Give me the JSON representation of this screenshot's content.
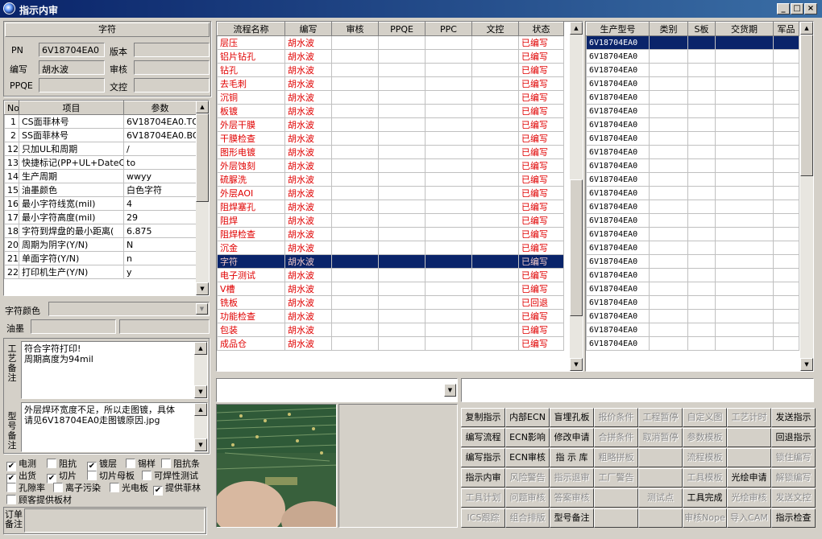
{
  "window": {
    "title": "指示内审",
    "min": "_",
    "max": "□",
    "close": "×"
  },
  "left": {
    "section_title": "字符",
    "pn_label": "PN",
    "pn_value": "6V18704EA0",
    "version_label": "版本",
    "version_value": "",
    "writer_label": "编写",
    "writer_value": "胡水波",
    "review_label": "审核",
    "review_value": "",
    "ppqe_label": "PPQE",
    "ppqe_value": "",
    "doc_label": "文控",
    "doc_value": "",
    "params": {
      "headers": [
        "No",
        "项目",
        "参数"
      ],
      "rows": [
        [
          "1",
          "CS面菲林号",
          "6V18704EA0.TO"
        ],
        [
          "2",
          "SS面菲林号",
          "6V18704EA0.BO"
        ],
        [
          "12",
          "只加UL和周期",
          "/"
        ],
        [
          "13",
          "快捷标记(PP+UL+DateCo",
          "to"
        ],
        [
          "14",
          "生产周期",
          "wwyy"
        ],
        [
          "15",
          "油墨颜色",
          "白色字符"
        ],
        [
          "16",
          "最小字符线宽(mil)",
          "4"
        ],
        [
          "17",
          "最小字符高度(mil)",
          "29"
        ],
        [
          "18",
          "字符到焊盘的最小距离(",
          "6.875"
        ],
        [
          "20",
          "周期为阴字(Y/N)",
          "N"
        ],
        [
          "21",
          "单面字符(Y/N)",
          "n"
        ],
        [
          "22",
          "打印机生产(Y/N)",
          "y"
        ]
      ]
    },
    "char_color_label": "字符颜色",
    "char_color_value": "",
    "ink_label": "油墨",
    "process_note_label": "工艺备注",
    "process_note_lines": [
      "符合字符打印!",
      "周期高度为94mil"
    ],
    "model_note_label": "型号备注",
    "model_note_lines": [
      "外层焊环宽度不足，所以走图镀，具体",
      "请见6V18704EA0走图镀原因.jpg"
    ],
    "checks": [
      {
        "label": "电测",
        "checked": true
      },
      {
        "label": "阻抗",
        "checked": false
      },
      {
        "label": "镀层",
        "checked": true
      },
      {
        "label": "锡样",
        "checked": false
      },
      {
        "label": "阻抗条",
        "checked": false
      },
      {
        "label": "出货",
        "checked": true
      },
      {
        "label": "切片",
        "checked": true
      },
      {
        "label": "切片母板",
        "checked": false
      },
      {
        "label": "可焊性测试",
        "checked": false
      },
      {
        "label": "孔隙率",
        "checked": false
      },
      {
        "label": "离子污染",
        "checked": false
      },
      {
        "label": "光电板",
        "checked": false
      },
      {
        "label": "提供菲林",
        "checked": true
      },
      {
        "label": "顾客提供板材",
        "checked": false
      }
    ],
    "order_note_label": "订单备注"
  },
  "flow": {
    "headers": [
      "流程名称",
      "编写",
      "审核",
      "PPQE",
      "PPC",
      "文控",
      "状态"
    ],
    "rows": [
      [
        "层压",
        "胡水波",
        "",
        "",
        "",
        "",
        "已编写"
      ],
      [
        "铝片钻孔",
        "胡水波",
        "",
        "",
        "",
        "",
        "已编写"
      ],
      [
        "钻孔",
        "胡水波",
        "",
        "",
        "",
        "",
        "已编写"
      ],
      [
        "去毛刺",
        "胡水波",
        "",
        "",
        "",
        "",
        "已编写"
      ],
      [
        "沉铜",
        "胡水波",
        "",
        "",
        "",
        "",
        "已编写"
      ],
      [
        "板镀",
        "胡水波",
        "",
        "",
        "",
        "",
        "已编写"
      ],
      [
        "外层干膜",
        "胡水波",
        "",
        "",
        "",
        "",
        "已编写"
      ],
      [
        "干膜检查",
        "胡水波",
        "",
        "",
        "",
        "",
        "已编写"
      ],
      [
        "图形电镀",
        "胡水波",
        "",
        "",
        "",
        "",
        "已编写"
      ],
      [
        "外层蚀刻",
        "胡水波",
        "",
        "",
        "",
        "",
        "已编写"
      ],
      [
        "硫脲洗",
        "胡水波",
        "",
        "",
        "",
        "",
        "已编写"
      ],
      [
        "外层AOI",
        "胡水波",
        "",
        "",
        "",
        "",
        "已编写"
      ],
      [
        "阻焊塞孔",
        "胡水波",
        "",
        "",
        "",
        "",
        "已编写"
      ],
      [
        "阻焊",
        "胡水波",
        "",
        "",
        "",
        "",
        "已编写"
      ],
      [
        "阻焊检查",
        "胡水波",
        "",
        "",
        "",
        "",
        "已编写"
      ],
      [
        "沉金",
        "胡水波",
        "",
        "",
        "",
        "",
        "已编写"
      ],
      [
        "字符",
        "胡水波",
        "",
        "",
        "",
        "",
        "已编写"
      ],
      [
        "电子测试",
        "胡水波",
        "",
        "",
        "",
        "",
        "已编写"
      ],
      [
        "V槽",
        "胡水波",
        "",
        "",
        "",
        "",
        "已编写"
      ],
      [
        "铣板",
        "胡水波",
        "",
        "",
        "",
        "",
        "已回退"
      ],
      [
        "功能检查",
        "胡水波",
        "",
        "",
        "",
        "",
        "已编写"
      ],
      [
        "包装",
        "胡水波",
        "",
        "",
        "",
        "",
        "已编写"
      ],
      [
        "成品仓",
        "胡水波",
        "",
        "",
        "",
        "",
        "已编写"
      ]
    ],
    "selected_index": 16
  },
  "models": {
    "headers": [
      "生产型号",
      "类别",
      "S板",
      "交货期",
      "军品"
    ],
    "rows": [
      "6V18704EA0",
      "6V18704EA0",
      "6V18704EA0",
      "6V18704EA0",
      "6V18704EA0",
      "6V18704EA0",
      "6V18704EA0",
      "6V18704EA0",
      "6V18704EA0",
      "6V18704EA0",
      "6V18704EA0",
      "6V18704EA0",
      "6V18704EA0",
      "6V18704EA0",
      "6V18704EA0",
      "6V18704EA0",
      "6V18704EA0",
      "6V18704EA0",
      "6V18704EA0",
      "6V18704EA0",
      "6V18704EA0",
      "6V18704EA0",
      "6V18704EA0"
    ],
    "selected_index": 0
  },
  "buttons": [
    [
      "复制指示",
      "内部ECN",
      "盲埋孔板",
      "报价条件",
      "工程暂停",
      "自定义图",
      "工艺计时",
      "发送指示"
    ],
    [
      "编写流程",
      "ECN影响",
      "修改申请",
      "合拼条件",
      "取消暂停",
      "参数模板",
      "",
      "回退指示"
    ],
    [
      "编写指示",
      "ECN审核",
      "指 示 库",
      "粗略拼板",
      "",
      "流程模板",
      "",
      "锁住编写"
    ],
    [
      "指示内审",
      "风险警告",
      "指示退审",
      "工厂警告",
      "",
      "工具模板",
      "光绘申请",
      "解锁编写"
    ],
    [
      "工具计划",
      "问题审核",
      "答案审核",
      "",
      "测试点",
      "工具完成",
      "光绘审核",
      "发送文控"
    ],
    [
      "ICS跟踪",
      "组合排版",
      "型号备注",
      "",
      "",
      "审核Nope",
      "导入CAM",
      "指示检查"
    ]
  ],
  "buttons_disabled": [
    [
      false,
      false,
      false,
      true,
      true,
      true,
      true,
      false
    ],
    [
      false,
      false,
      false,
      true,
      true,
      true,
      true,
      false
    ],
    [
      false,
      false,
      false,
      true,
      true,
      true,
      true,
      true
    ],
    [
      false,
      true,
      true,
      true,
      true,
      true,
      false,
      true
    ],
    [
      true,
      true,
      true,
      true,
      true,
      false,
      true,
      true
    ],
    [
      true,
      true,
      false,
      true,
      true,
      true,
      true,
      false
    ]
  ],
  "colors": {
    "title_bar": "#0a246a",
    "status_text": "#e00000",
    "selection": "#0a246a"
  }
}
